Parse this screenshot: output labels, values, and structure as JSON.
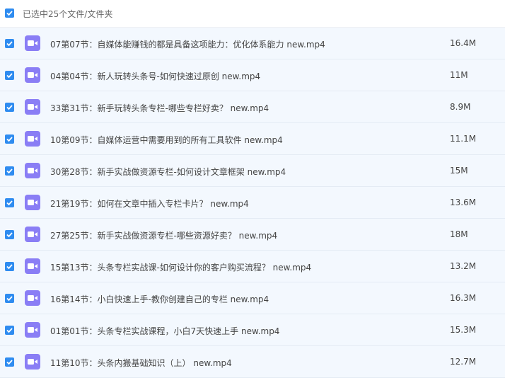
{
  "header": {
    "selection_text": "已选中25个文件/文件夹"
  },
  "files": [
    {
      "name": "07第07节：自媒体能赚钱的都是具备这项能力：优化体系能力 new.mp4",
      "size": "16.4M"
    },
    {
      "name": "04第04节：新人玩转头条号-如何快速过原创 new.mp4",
      "size": "11M"
    },
    {
      "name": "33第31节：新手玩转头条专栏-哪些专栏好卖？ new.mp4",
      "size": "8.9M"
    },
    {
      "name": "10第09节：自媒体运营中需要用到的所有工具软件 new.mp4",
      "size": "11.1M"
    },
    {
      "name": "30第28节：新手实战做资源专栏-如何设计文章框架 new.mp4",
      "size": "15M"
    },
    {
      "name": "21第19节：如何在文章中插入专栏卡片？ new.mp4",
      "size": "13.6M"
    },
    {
      "name": "27第25节：新手实战做资源专栏-哪些资源好卖？ new.mp4",
      "size": "18M"
    },
    {
      "name": "15第13节：头条专栏实战课-如何设计你的客户购买流程？ new.mp4",
      "size": "13.2M"
    },
    {
      "name": "16第14节：小白快速上手-教你创建自己的专栏 new.mp4",
      "size": "16.3M"
    },
    {
      "name": "01第01节：头条专栏实战课程，小白7天快速上手 new.mp4",
      "size": "15.3M"
    },
    {
      "name": "11第10节：头条内搬基础知识（上） new.mp4",
      "size": "12.7M"
    }
  ]
}
